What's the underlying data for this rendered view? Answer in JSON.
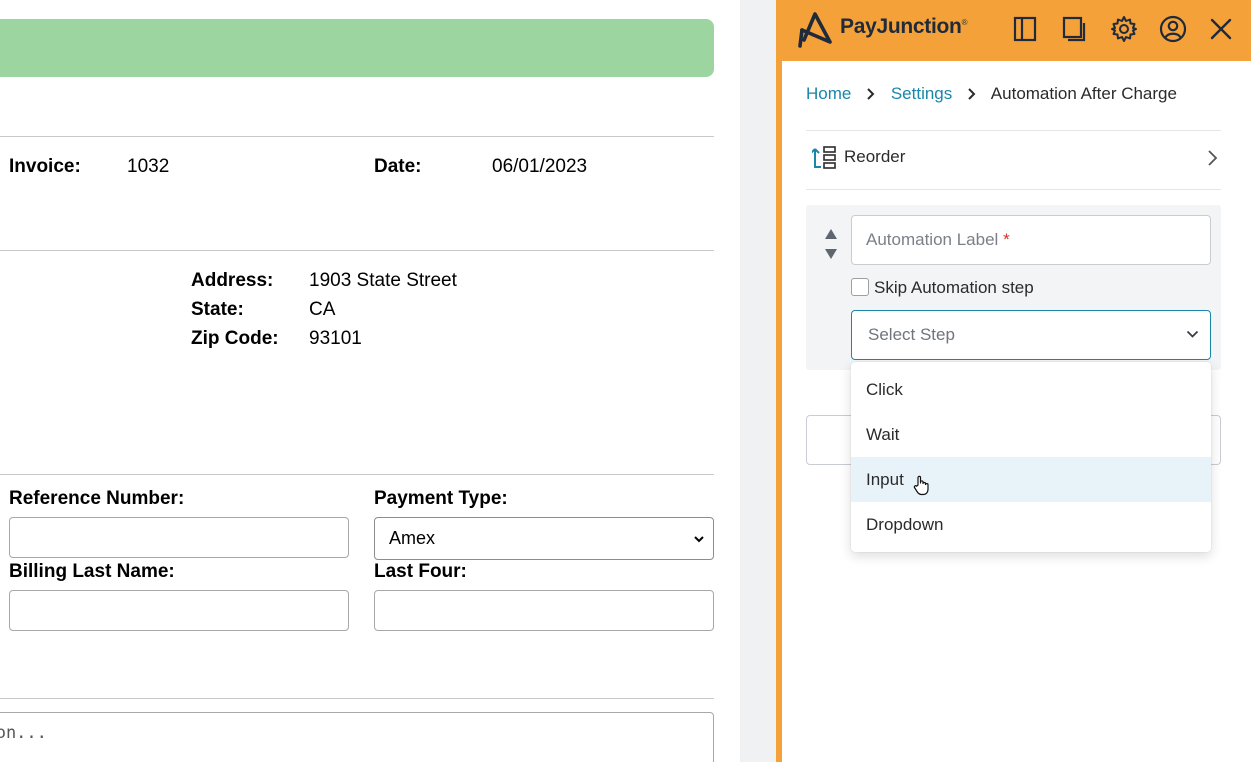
{
  "invoice": {
    "invoice_label": "Invoice:",
    "invoice_value": "1032",
    "date_label": "Date:",
    "date_value": "06/01/2023"
  },
  "address": {
    "address_label": "Address:",
    "address_value": "1903 State Street",
    "state_label": "State:",
    "state_value": "CA",
    "zip_label": "Zip Code:",
    "zip_value": "93101"
  },
  "payment": {
    "reference_label": "Reference Number:",
    "reference_value": "",
    "payment_type_label": "Payment Type:",
    "payment_type_value": "Amex",
    "billing_last_name_label": "Billing Last Name:",
    "billing_last_name_value": "",
    "last_four_label": "Last Four:",
    "last_four_value": ""
  },
  "notes": {
    "placeholder_visible": "ction..."
  },
  "panel": {
    "brand": "PayJunction",
    "brand_mark": "®",
    "header_icons": [
      "sidebar-layout-icon",
      "popout-window-icon",
      "settings-gear-icon",
      "user-account-icon",
      "close-icon"
    ],
    "breadcrumb": {
      "home": "Home",
      "settings": "Settings",
      "current": "Automation After Charge"
    },
    "reorder_label": "Reorder",
    "step": {
      "label_placeholder": "Automation Label",
      "required_mark": "*",
      "skip_label": "Skip Automation step",
      "select_placeholder": "Select Step",
      "options": [
        "Click",
        "Wait",
        "Input",
        "Dropdown"
      ],
      "hovered_option": "Input"
    }
  },
  "colors": {
    "panel_accent": "#f4a13a",
    "link": "#1a86a8",
    "banner": "#9dd5a0",
    "option_hover": "#e7f3f8"
  }
}
